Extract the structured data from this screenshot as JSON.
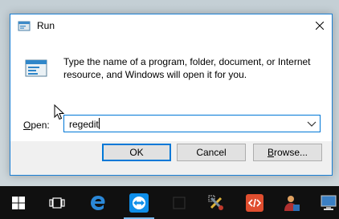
{
  "window": {
    "title": "Run",
    "title_icon": "run-icon",
    "close_icon": "close-icon"
  },
  "content": {
    "icon": "run-dialog-icon",
    "message": "Type the name of a program, folder, document, or Internet resource, and Windows will open it for you.",
    "open_label_accel": "O",
    "open_label_rest": "pen:",
    "input_value": "regedit",
    "dropdown_icon": "chevron-down-icon"
  },
  "buttons": {
    "ok": "OK",
    "cancel": "Cancel",
    "browse_accel": "B",
    "browse_rest": "rowse..."
  },
  "taskbar": {
    "items": [
      {
        "icon": "windows-start-icon"
      },
      {
        "icon": "task-view-icon"
      },
      {
        "icon": "edge-browser-icon"
      },
      {
        "icon": "teamviewer-icon"
      },
      {
        "icon": "app-icon"
      },
      {
        "icon": "tools-icon"
      },
      {
        "icon": "code-app-icon"
      },
      {
        "icon": "user-app-icon"
      },
      {
        "icon": "computer-app-icon"
      }
    ]
  },
  "colors": {
    "accent": "#0078d7",
    "taskbar": "#101010",
    "footer": "#f0f0f0"
  }
}
